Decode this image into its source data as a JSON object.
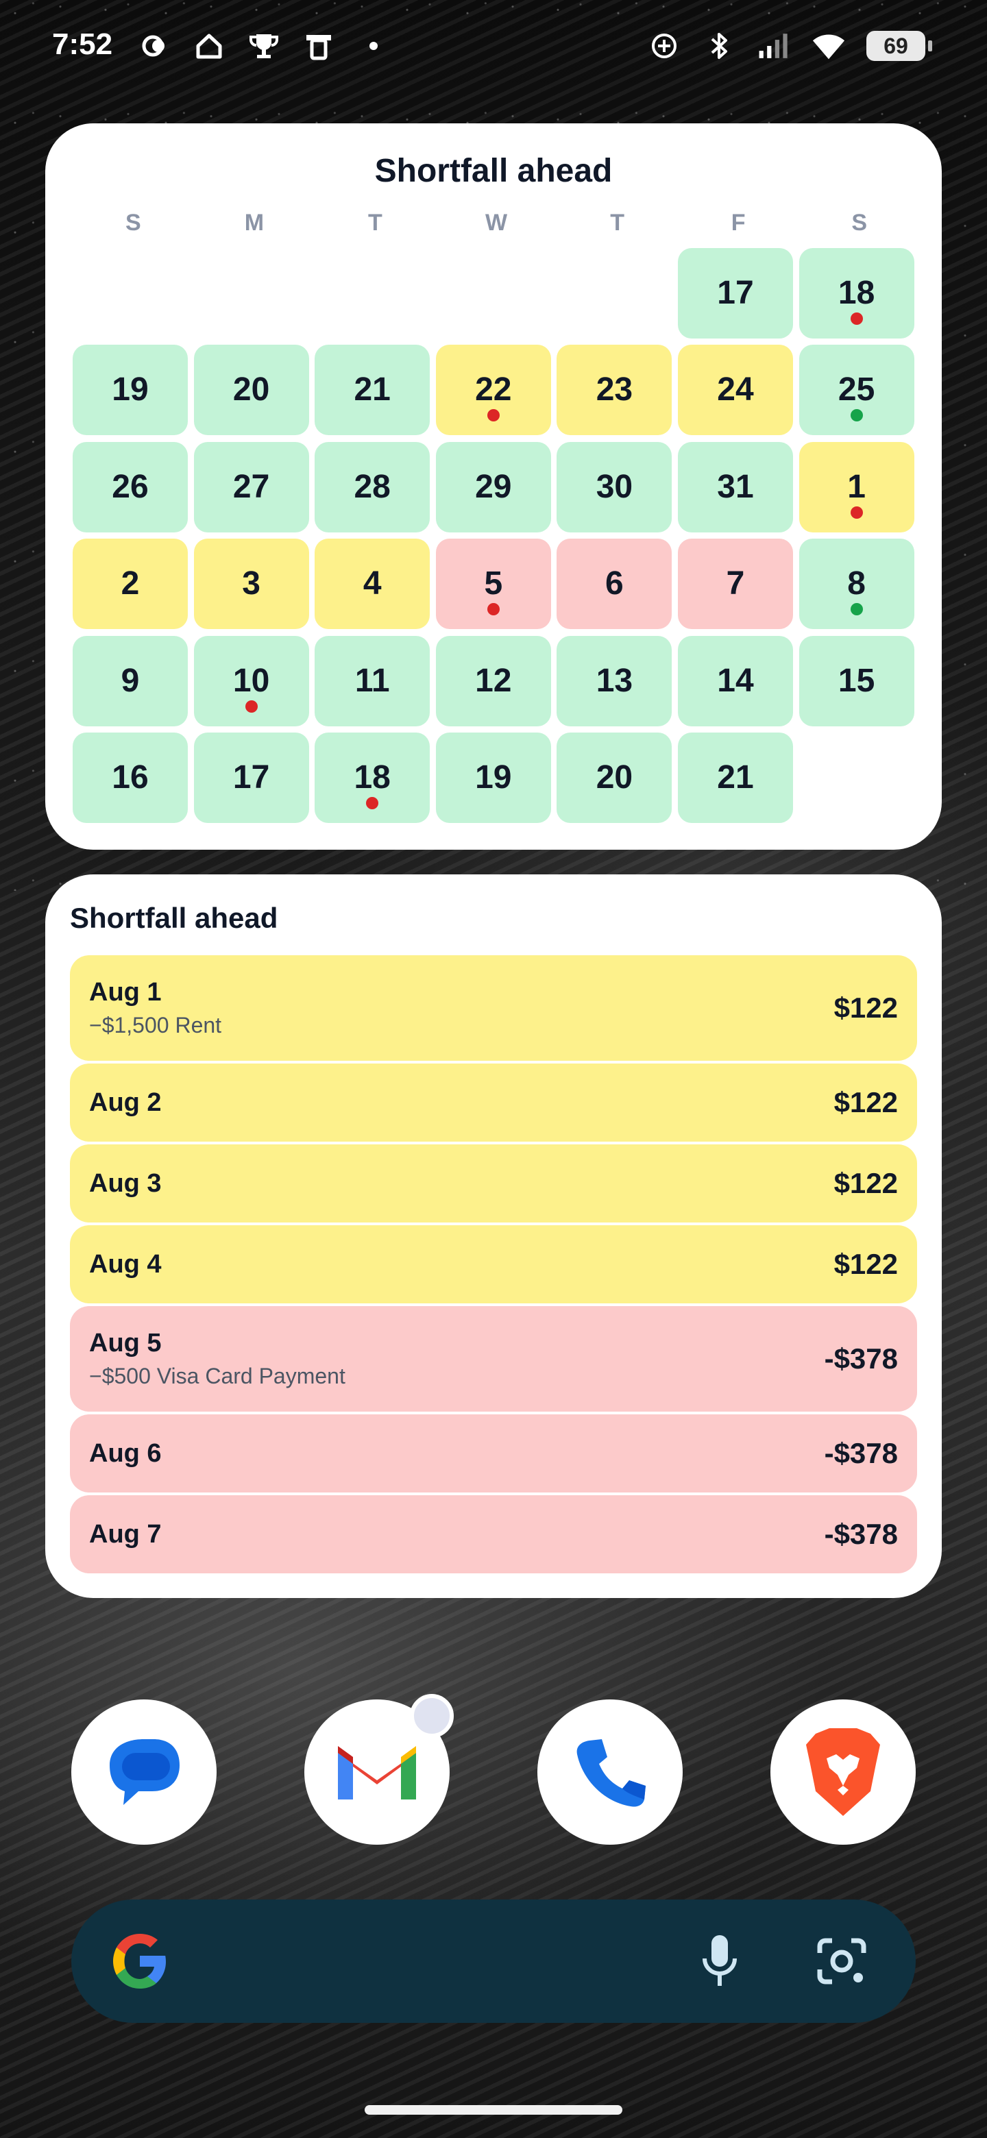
{
  "status_bar": {
    "time": "7:52",
    "battery": "69",
    "left_icons": [
      "weather-icon",
      "home-icon",
      "trophy-icon",
      "pin-icon",
      "dot-icon"
    ],
    "right_icons": [
      "crosshair-icon",
      "bluetooth-icon",
      "signal-icon",
      "wifi-icon"
    ]
  },
  "calendar_widget": {
    "title": "Shortfall ahead",
    "weekdays": [
      "S",
      "M",
      "T",
      "W",
      "T",
      "F",
      "S"
    ],
    "colors": {
      "green": "#c3f3d7",
      "yellow": "#fdf18b",
      "red": "#fccaca",
      "dot_red": "#dc2626",
      "dot_green": "#16a34a"
    },
    "weeks": [
      [
        null,
        null,
        null,
        null,
        null,
        {
          "day": "17",
          "status": "green"
        },
        {
          "day": "18",
          "status": "green",
          "dot": "red"
        }
      ],
      [
        {
          "day": "19",
          "status": "green"
        },
        {
          "day": "20",
          "status": "green"
        },
        {
          "day": "21",
          "status": "green"
        },
        {
          "day": "22",
          "status": "yellow",
          "dot": "red"
        },
        {
          "day": "23",
          "status": "yellow"
        },
        {
          "day": "24",
          "status": "yellow"
        },
        {
          "day": "25",
          "status": "green",
          "dot": "green"
        }
      ],
      [
        {
          "day": "26",
          "status": "green"
        },
        {
          "day": "27",
          "status": "green"
        },
        {
          "day": "28",
          "status": "green"
        },
        {
          "day": "29",
          "status": "green"
        },
        {
          "day": "30",
          "status": "green"
        },
        {
          "day": "31",
          "status": "green"
        },
        {
          "day": "1",
          "status": "yellow",
          "dot": "red"
        }
      ],
      [
        {
          "day": "2",
          "status": "yellow"
        },
        {
          "day": "3",
          "status": "yellow"
        },
        {
          "day": "4",
          "status": "yellow"
        },
        {
          "day": "5",
          "status": "red",
          "dot": "red"
        },
        {
          "day": "6",
          "status": "red"
        },
        {
          "day": "7",
          "status": "red"
        },
        {
          "day": "8",
          "status": "green",
          "dot": "green"
        }
      ],
      [
        {
          "day": "9",
          "status": "green"
        },
        {
          "day": "10",
          "status": "green",
          "dot": "red"
        },
        {
          "day": "11",
          "status": "green"
        },
        {
          "day": "12",
          "status": "green"
        },
        {
          "day": "13",
          "status": "green"
        },
        {
          "day": "14",
          "status": "green"
        },
        {
          "day": "15",
          "status": "green"
        }
      ],
      [
        {
          "day": "16",
          "status": "green"
        },
        {
          "day": "17",
          "status": "green"
        },
        {
          "day": "18",
          "status": "green",
          "dot": "red"
        },
        {
          "day": "19",
          "status": "green"
        },
        {
          "day": "20",
          "status": "green"
        },
        {
          "day": "21",
          "status": "green"
        },
        null
      ]
    ]
  },
  "list_widget": {
    "title": "Shortfall ahead",
    "rows": [
      {
        "date": "Aug 1",
        "sub": "−$1,500 Rent",
        "amount": "$122",
        "status": "yellow"
      },
      {
        "date": "Aug 2",
        "sub": "",
        "amount": "$122",
        "status": "yellow"
      },
      {
        "date": "Aug 3",
        "sub": "",
        "amount": "$122",
        "status": "yellow"
      },
      {
        "date": "Aug 4",
        "sub": "",
        "amount": "$122",
        "status": "yellow"
      },
      {
        "date": "Aug 5",
        "sub": "−$500 Visa Card Payment",
        "amount": "-$378",
        "status": "red"
      },
      {
        "date": "Aug 6",
        "sub": "",
        "amount": "-$378",
        "status": "red"
      },
      {
        "date": "Aug 7",
        "sub": "",
        "amount": "-$378",
        "status": "red"
      }
    ]
  },
  "dock": {
    "apps": [
      {
        "name": "messages-app-icon"
      },
      {
        "name": "gmail-app-icon",
        "badge": true
      },
      {
        "name": "phone-app-icon"
      },
      {
        "name": "brave-app-icon"
      }
    ]
  },
  "search_bar": {
    "icons": [
      "google-g-icon",
      "microphone-icon",
      "google-lens-icon"
    ],
    "background": "#0f3140"
  }
}
